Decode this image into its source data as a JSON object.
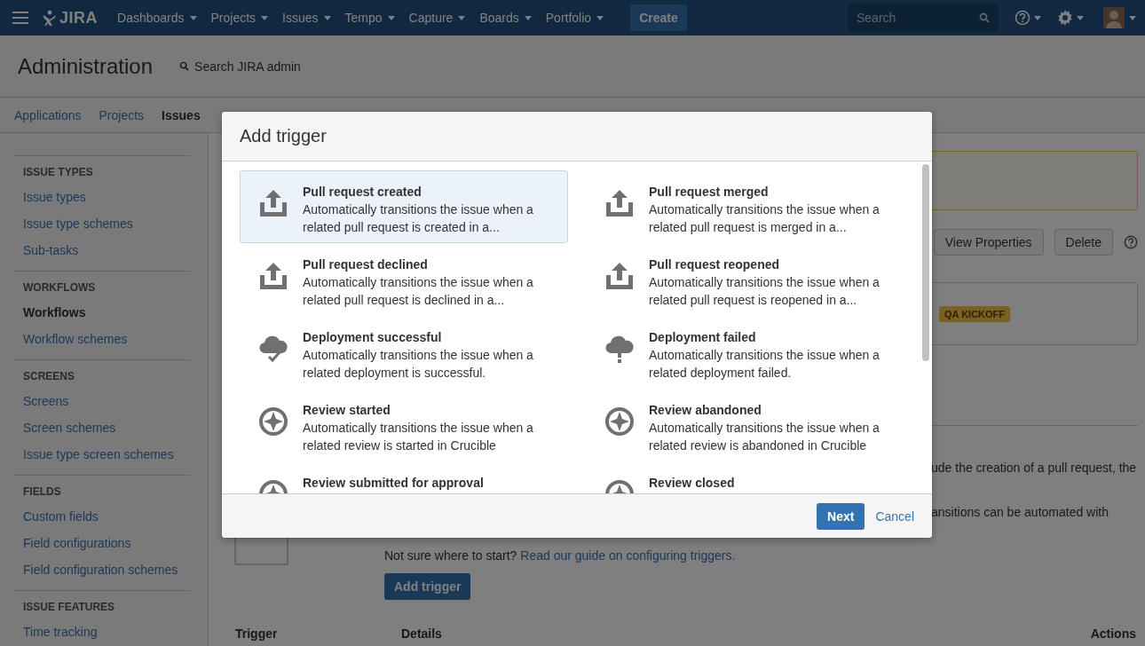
{
  "nav": {
    "logo": "JIRA",
    "items": [
      {
        "label": "Dashboards"
      },
      {
        "label": "Projects"
      },
      {
        "label": "Issues"
      },
      {
        "label": "Tempo"
      },
      {
        "label": "Capture"
      },
      {
        "label": "Boards"
      },
      {
        "label": "Portfolio"
      }
    ],
    "create": "Create",
    "search": {
      "placeholder": "Search"
    }
  },
  "admin": {
    "title": "Administration",
    "search": "Search JIRA admin"
  },
  "tabs": [
    {
      "label": "Applications",
      "selected": false
    },
    {
      "label": "Projects",
      "selected": false
    },
    {
      "label": "Issues",
      "selected": true
    }
  ],
  "sidebar": [
    {
      "heading": "ISSUE TYPES",
      "items": [
        {
          "label": "Issue types",
          "selected": false
        },
        {
          "label": "Issue type schemes",
          "selected": false
        },
        {
          "label": "Sub-tasks",
          "selected": false
        }
      ]
    },
    {
      "heading": "WORKFLOWS",
      "items": [
        {
          "label": "Workflows",
          "selected": true
        },
        {
          "label": "Workflow schemes",
          "selected": false
        }
      ]
    },
    {
      "heading": "SCREENS",
      "items": [
        {
          "label": "Screens",
          "selected": false
        },
        {
          "label": "Screen schemes",
          "selected": false
        },
        {
          "label": "Issue type screen schemes",
          "selected": false
        }
      ]
    },
    {
      "heading": "FIELDS",
      "items": [
        {
          "label": "Custom fields",
          "selected": false
        },
        {
          "label": "Field configurations",
          "selected": false
        },
        {
          "label": "Field configuration schemes",
          "selected": false
        }
      ]
    },
    {
      "heading": "ISSUE FEATURES",
      "items": [
        {
          "label": "Time tracking",
          "selected": false
        }
      ]
    }
  ],
  "content": {
    "toolbar": [
      "View Properties",
      "Delete"
    ],
    "status": "QA KICKOFF",
    "fragments": [
      "ude the creation of a pull request, the",
      "ansitions can be automated with"
    ],
    "help": "Not sure where to start?",
    "help_link": "Read our guide on configuring triggers.",
    "add_button": "Add trigger",
    "columns": [
      "Trigger",
      "Details",
      "Actions"
    ]
  },
  "modal": {
    "title": "Add trigger",
    "triggers": [
      {
        "kind": "upload",
        "title": "Pull request created",
        "description": "Automatically transitions the issue when a related pull request is created in a...",
        "selected": true
      },
      {
        "kind": "upload",
        "title": "Pull request merged",
        "description": "Automatically transitions the issue when a related pull request is merged in a...",
        "selected": false
      },
      {
        "kind": "upload",
        "title": "Pull request declined",
        "description": "Automatically transitions the issue when a related pull request is declined in a...",
        "selected": false
      },
      {
        "kind": "upload",
        "title": "Pull request reopened",
        "description": "Automatically transitions the issue when a related pull request is reopened in a...",
        "selected": false
      },
      {
        "kind": "deploy-ok",
        "title": "Deployment successful",
        "description": "Automatically transitions the issue when a related deployment is successful.",
        "selected": false
      },
      {
        "kind": "deploy-fail",
        "title": "Deployment failed",
        "description": "Automatically transitions the issue when a related deployment failed.",
        "selected": false
      },
      {
        "kind": "review",
        "title": "Review started",
        "description": "Automatically transitions the issue when a related review is started in Crucible",
        "selected": false
      },
      {
        "kind": "review",
        "title": "Review abandoned",
        "description": "Automatically transitions the issue when a related review is abandoned in Crucible",
        "selected": false
      },
      {
        "kind": "review",
        "title": "Review submitted for approval",
        "selected": false
      },
      {
        "kind": "review",
        "title": "Review closed",
        "selected": false
      }
    ],
    "next": "Next",
    "cancel": "Cancel"
  }
}
